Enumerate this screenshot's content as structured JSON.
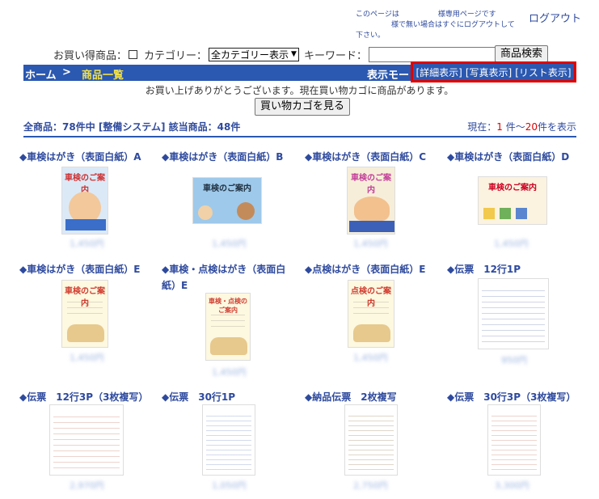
{
  "header": {
    "notice_line1": "このページは",
    "notice_line1b": "様専用ページです",
    "notice_line2": "様で無い場合はすぐにログアウトして下さい。",
    "logout": "ログアウト"
  },
  "search": {
    "deal_label": "お買い得商品：",
    "category_label": "カテゴリー：",
    "category_value": "全カテゴリー表示",
    "keyword_label": "キーワード：",
    "keyword_value": "",
    "search_button": "商品検索"
  },
  "navbar": {
    "home": "ホーム",
    "separator": ">",
    "current": "商品一覧",
    "display_mode_label": "表示モード",
    "modes": [
      "[詳細表示]",
      "[写真表示]",
      "[リスト表示]"
    ]
  },
  "cart": {
    "message": "お買い上げありがとうございます。現在買い物カゴに商品があります。",
    "view_button": "買い物カゴを見る"
  },
  "summary": {
    "count_text": "全商品：78件中 [整備システム] 該当商品：48件",
    "range_prefix": "現在：",
    "range_start": "1",
    "range_mid": " 件～",
    "range_end": "20",
    "range_suffix": "件を表示"
  },
  "products": [
    {
      "name": "◆車検はがき（表面白紙）A",
      "price": "1,450円"
    },
    {
      "name": "◆車検はがき（表面白紙）B",
      "price": "1,450円"
    },
    {
      "name": "◆車検はがき（表面白紙）C",
      "price": "1,450円"
    },
    {
      "name": "◆車検はがき（表面白紙）D",
      "price": "1,450円"
    },
    {
      "name": "◆車検はがき（表面白紙）E",
      "price": "1,450円"
    },
    {
      "name": "◆車検・点検はがき（表面白紙）E",
      "price": "1,450円"
    },
    {
      "name": "◆点検はがき（表面白紙）E",
      "price": "1,450円"
    },
    {
      "name": "◆伝票　12行1P",
      "price": "950円"
    },
    {
      "name": "◆伝票　12行3P（3枚複写）",
      "price": "2,970円"
    },
    {
      "name": "◆伝票　30行1P",
      "price": "1,050円"
    },
    {
      "name": "◆納品伝票　2枚複写",
      "price": "2,750円"
    },
    {
      "name": "◆伝票　30行3P（3枚複写）",
      "price": "3,300円"
    }
  ],
  "poster_titles": [
    "車検のご案内",
    "車検のご案内",
    "車検のご案内",
    "車検のご案内",
    "車検のご案内",
    "車検・点検のご案内",
    "点検のご案内"
  ],
  "colors": {
    "nav_bg": "#2b58b0",
    "link": "#2e4a9e",
    "highlight": "#e00000",
    "current_crumb": "#f0e04a"
  }
}
